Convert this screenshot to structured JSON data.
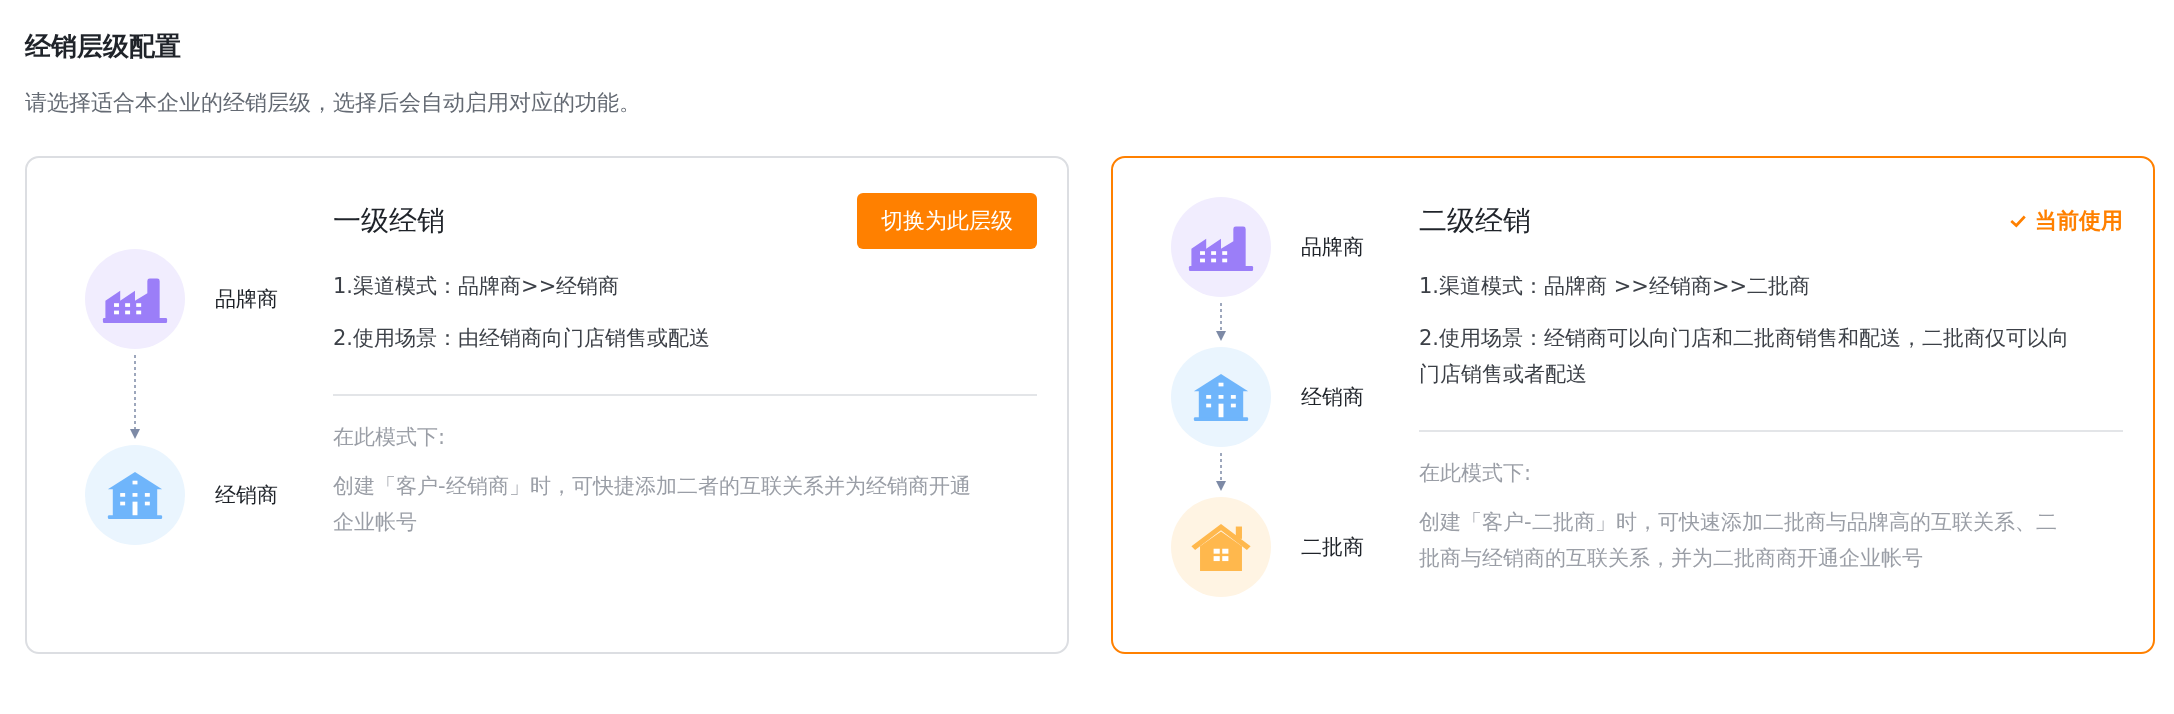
{
  "page": {
    "title": "经销层级配置",
    "description": "请选择适合本企业的经销层级，选择后会自动启用对应的功能。"
  },
  "levels": [
    {
      "title": "一级经销",
      "selected": false,
      "action_label": "切换为此层级",
      "nodes": [
        {
          "kind": "brand",
          "label": "品牌商"
        },
        {
          "kind": "dealer",
          "label": "经销商"
        }
      ],
      "features": [
        "1.渠道模式：品牌商>>经销商",
        "2.使用场景：由经销商向门店销售或配送"
      ],
      "note_title": "在此模式下:",
      "note": "创建「客户-经销商」时，可快捷添加二者的互联关系并为经销商开通企业帐号"
    },
    {
      "title": "二级经销",
      "selected": true,
      "action_label": "当前使用",
      "nodes": [
        {
          "kind": "brand",
          "label": "品牌商"
        },
        {
          "kind": "dealer",
          "label": "经销商"
        },
        {
          "kind": "subdealer",
          "label": "二批商"
        }
      ],
      "features": [
        "1.渠道模式：品牌商 >>经销商>>二批商",
        "2.使用场景：经销商可以向门店和二批商销售和配送，二批商仅可以向门店销售或者配送"
      ],
      "note_title": "在此模式下:",
      "note": "创建「客户-二批商」时，可快速添加二批商与品牌高的互联关系、二批商与经销商的互联关系，并为二批商商开通企业帐号"
    }
  ]
}
